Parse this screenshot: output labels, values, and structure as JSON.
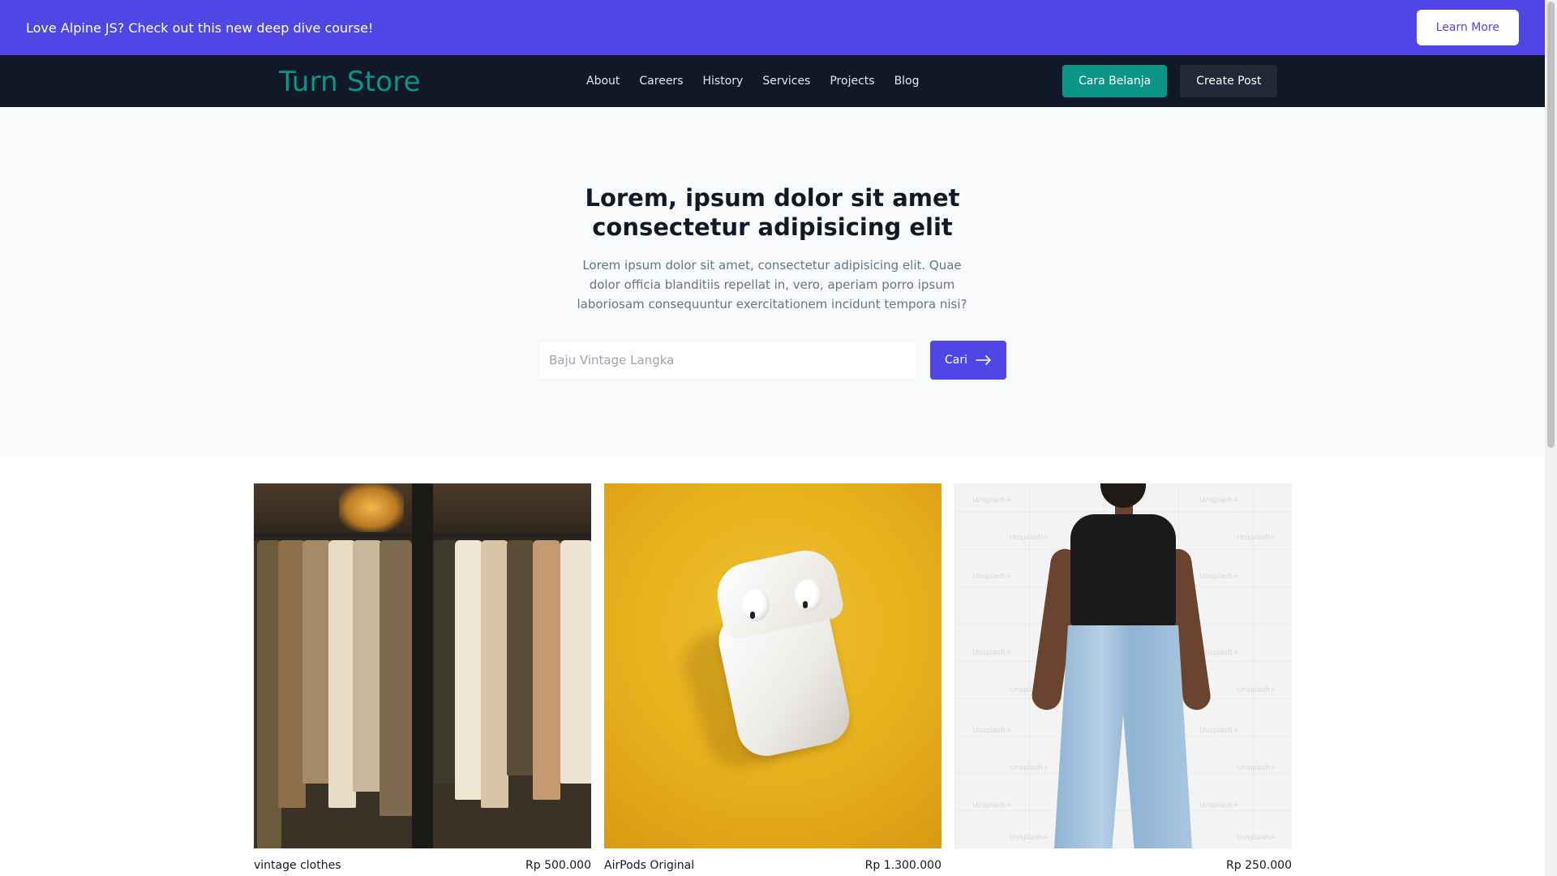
{
  "banner": {
    "text": "Love Alpine JS? Check out this new deep dive course!",
    "cta_label": "Learn More"
  },
  "navbar": {
    "logo": "Turn Store",
    "links": [
      "About",
      "Careers",
      "History",
      "Services",
      "Projects",
      "Blog"
    ],
    "cara_belanja_label": "Cara Belanja",
    "create_post_label": "Create Post"
  },
  "hero": {
    "title_line1": "Lorem, ipsum dolor sit amet",
    "title_line2": "consectetur adipisicing elit",
    "description": "Lorem ipsum dolor sit amet, consectetur adipisicing elit. Quae dolor officia blanditiis repellat in, vero, aperiam porro ipsum laboriosam consequuntur exercitationem incidunt tempora nisi?",
    "search_placeholder": "Baju Vintage Langka",
    "search_button_label": "Cari",
    "search_button_icon": "arrow-right-icon"
  },
  "products": [
    {
      "name": "vintage clothes",
      "price": "Rp 500.000",
      "image": "clothes-rack-photo"
    },
    {
      "name": "AirPods Original",
      "price": "Rp 1.300.000",
      "image": "airpods-photo"
    },
    {
      "name": "",
      "price": "Rp 250.000",
      "image": "model-jeans-photo"
    }
  ],
  "product_image_watermark": "Unsplash+",
  "colors": {
    "banner": "#4f46e5",
    "navbar": "#111827",
    "brand_teal": "#0d9488",
    "hero_bg": "#f9fafb",
    "search_button": "#4f46e5"
  }
}
